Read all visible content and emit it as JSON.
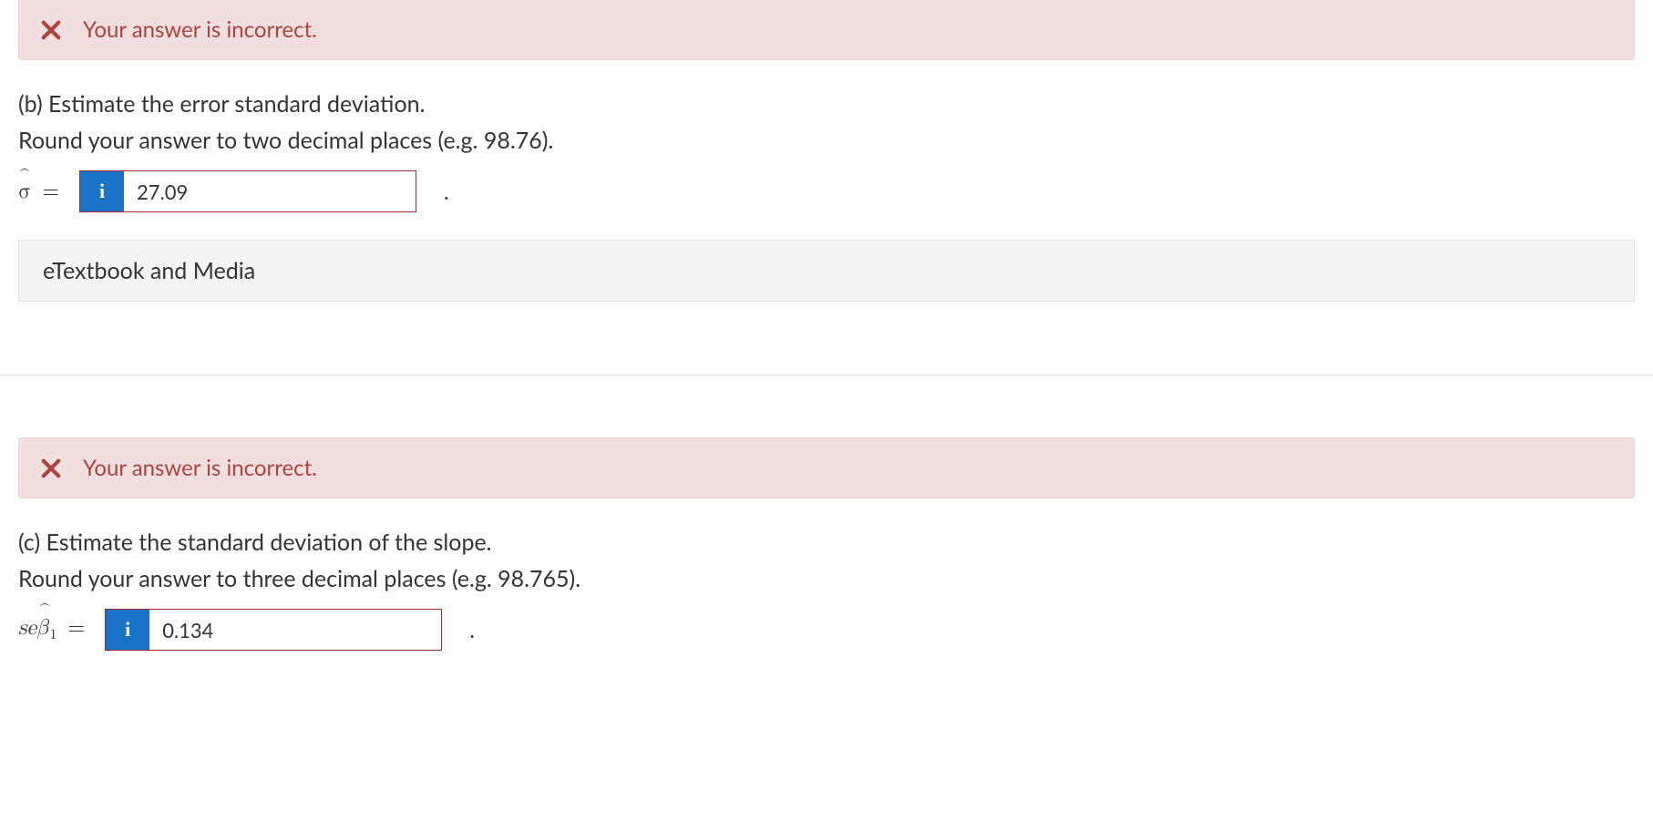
{
  "part_b": {
    "error_message": "Your answer is incorrect.",
    "prompt_line1": "(b) Estimate the error standard deviation.",
    "prompt_line2": "Round your answer to two decimal places (e.g. 98.76).",
    "symbol_sigma": "σ",
    "equals": "=",
    "info_label": "i",
    "input_value": "27.09",
    "period": "."
  },
  "resources": {
    "etextbook_label": "eTextbook and Media"
  },
  "part_c": {
    "error_message": "Your answer is incorrect.",
    "prompt_line1": "(c) Estimate the standard deviation of the slope.",
    "prompt_line2": "Round your answer to three decimal places (e.g. 98.765).",
    "symbol_se": "se",
    "symbol_beta": "β",
    "symbol_sub": "1",
    "equals": "=",
    "info_label": "i",
    "input_value": "0.134",
    "period": "."
  }
}
